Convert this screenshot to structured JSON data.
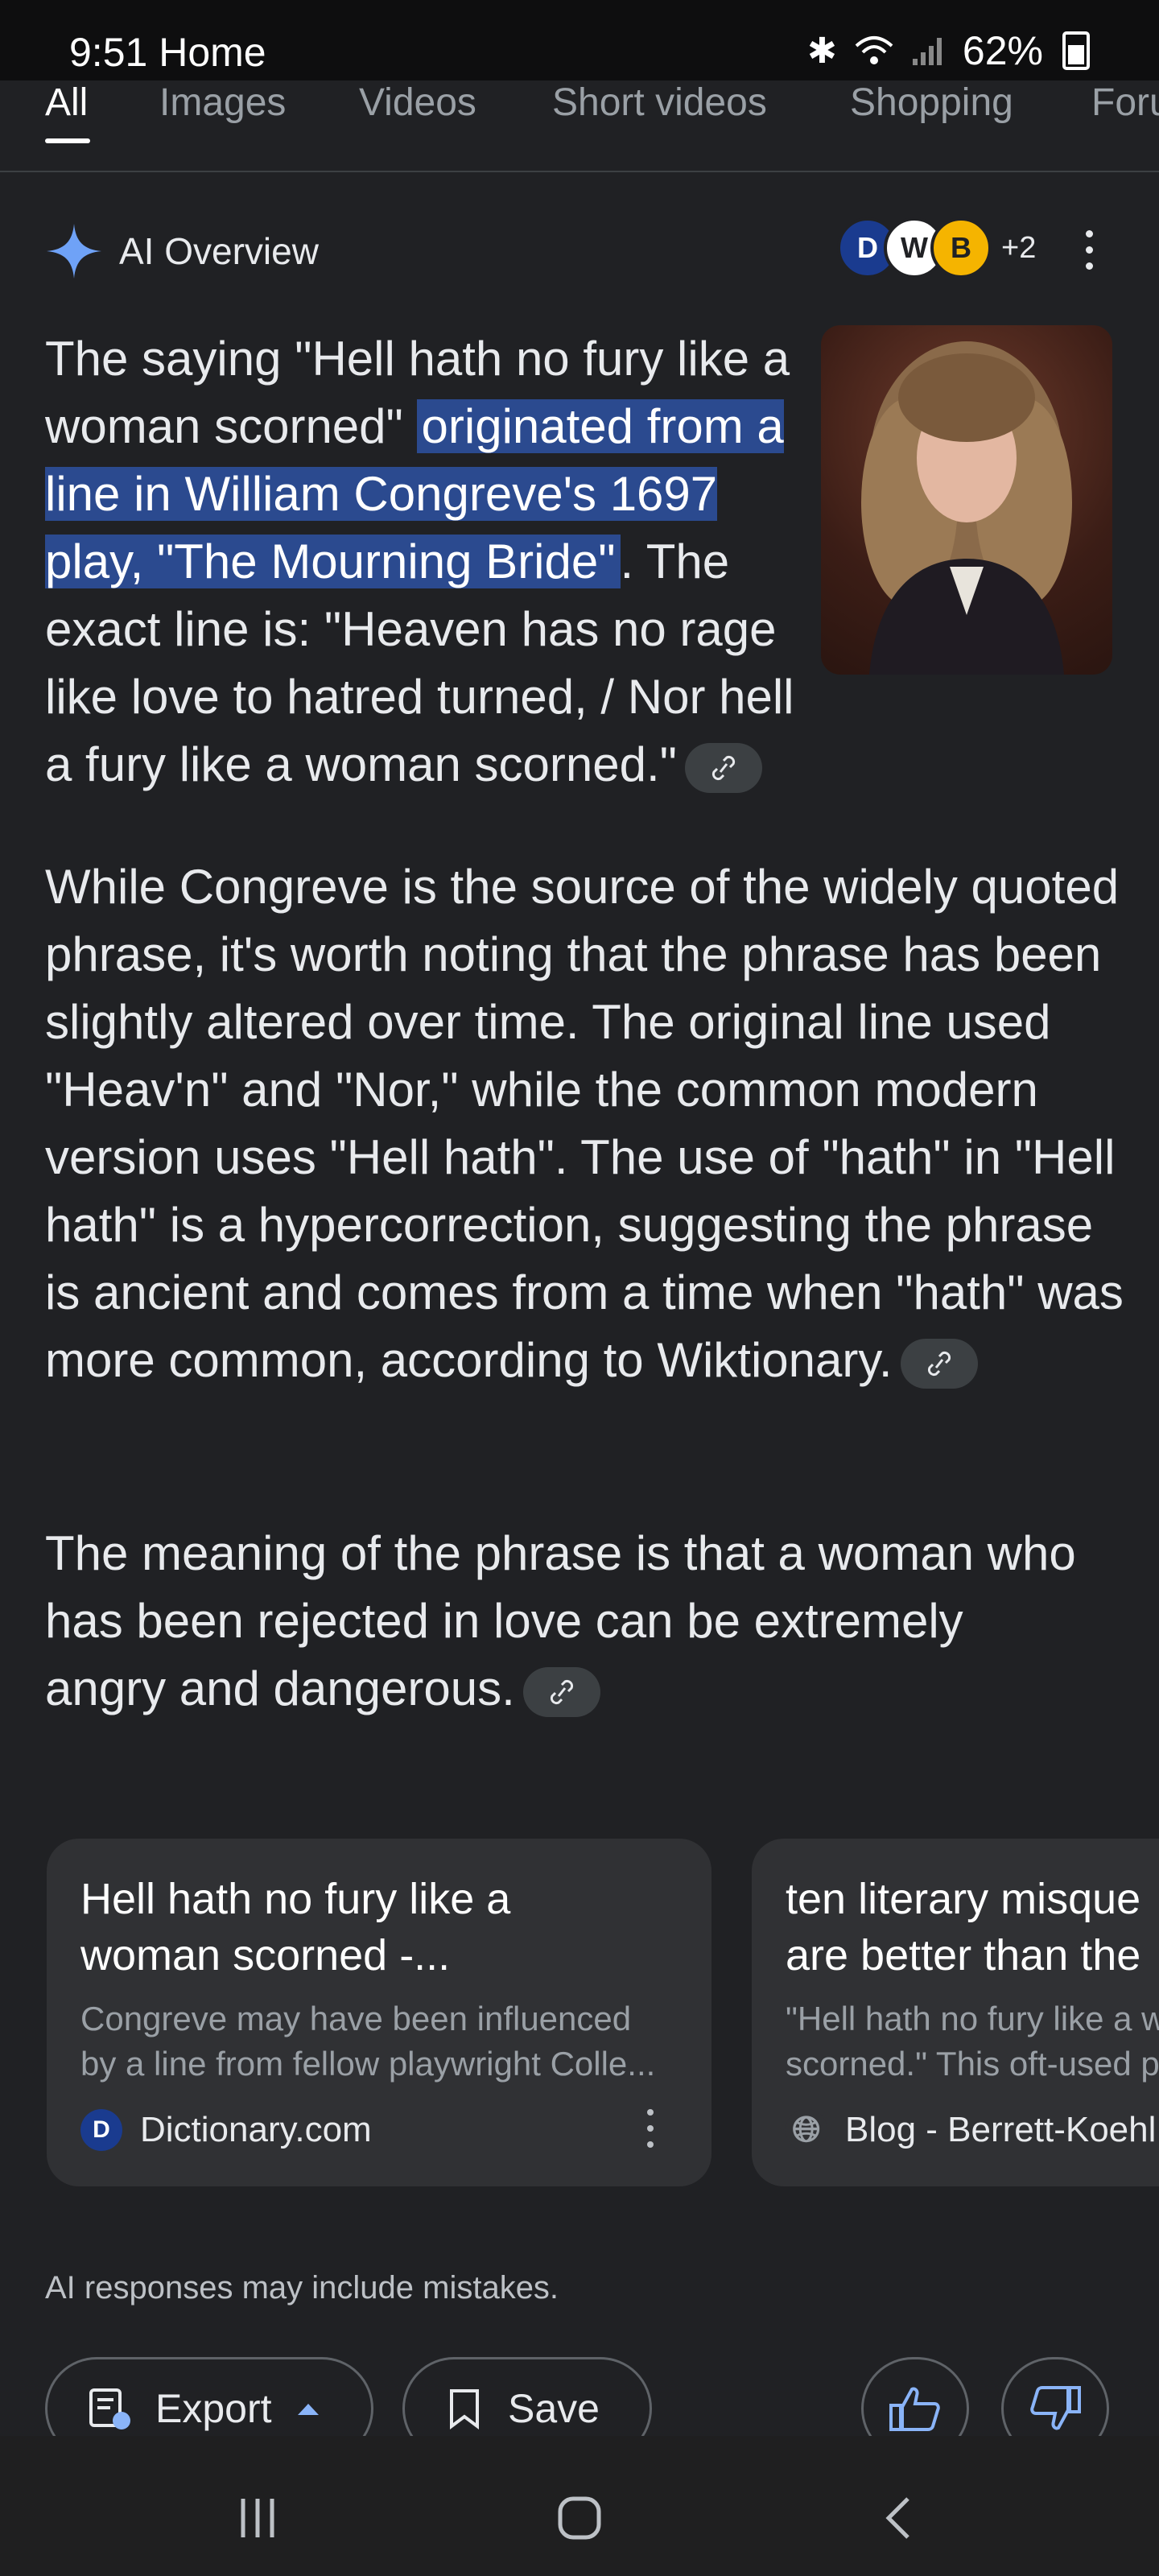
{
  "status_bar": {
    "time": "9:51",
    "label": "Home",
    "battery": "62%"
  },
  "tabs": [
    "All",
    "Images",
    "Videos",
    "Short videos",
    "Shopping",
    "Foru"
  ],
  "ai_overview": {
    "title": "AI Overview",
    "extra_sources": "+2",
    "p1_before": "The saying \"Hell hath no fury like a woman scorned\" ",
    "p1_highlight": "originated from a line in William Congreve's 1697 play, \"The Mourning Bride\"",
    "p1_after": ". The exact line is: \"Heaven has no rage like love to hatred turned, / Nor hell a fury like a woman scorned.\"",
    "p2": "While Congreve is the source of the widely quoted phrase, it's worth noting that the phrase has been slightly altered over time. The original line used \"Heav'n\" and \"Nor,\" while the common modern version uses \"Hell hath\". The use of \"hath\" in \"Hell hath\" is a hypercorrection, suggesting the phrase is ancient and comes from a time when \"hath\" was more common, according to Wiktionary.",
    "p3": "The meaning of the phrase is that a woman who has been rejected in love can be extremely angry and dangerous."
  },
  "cards": [
    {
      "title": "Hell hath no fury like a\nwoman scorned -...",
      "snippet": "Congreve may have been influenced\nby a line from fellow playwright Colle...",
      "source": "Dictionary.com"
    },
    {
      "title": "ten literary misque\nare better than the",
      "snippet": "\"Hell hath no fury like a w\nscorned.\" This oft-used p",
      "source": "Blog - Berrett-Koehl"
    }
  ],
  "disclaimer": "AI responses may include mistakes.",
  "actions": {
    "export": "Export",
    "save": "Save"
  },
  "colors": {
    "background": "#202124",
    "highlight": "#2b4a8f",
    "card": "#303134",
    "accent": "#8ab4f8"
  }
}
